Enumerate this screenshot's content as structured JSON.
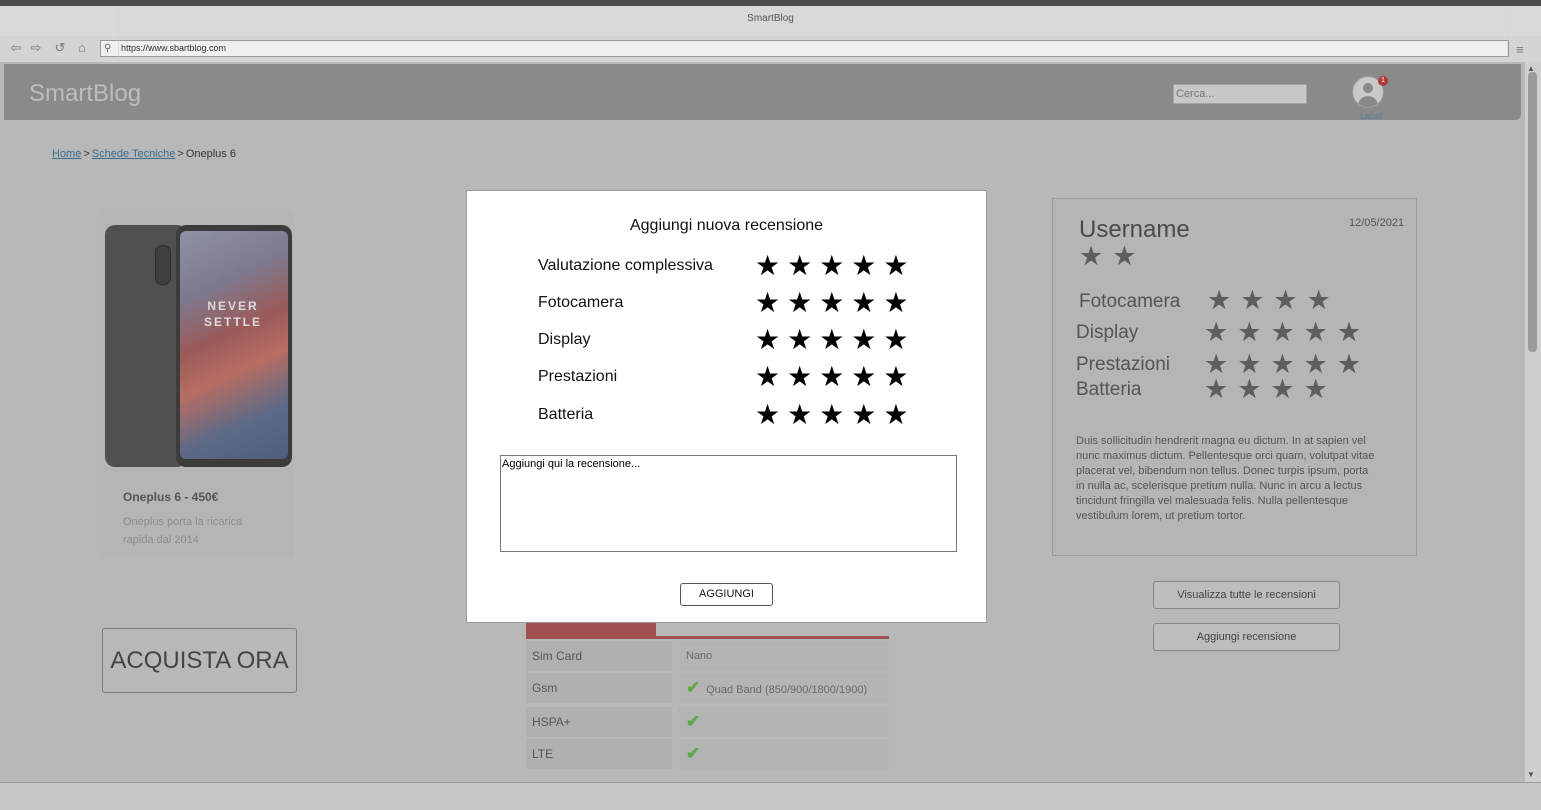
{
  "browser": {
    "window_title": "SmartBlog",
    "url": "https://www.sbartblog.com"
  },
  "header": {
    "logo": "SmartBlog",
    "search_placeholder": "Cerca...",
    "notification_count": "1",
    "avatar_label": "Label"
  },
  "breadcrumb": {
    "home": "Home",
    "section": "Schede Tecniche",
    "current": "Oneplus 6",
    "separator": ">"
  },
  "product": {
    "phone_screen_text_line1": "NEVER",
    "phone_screen_text_line2": "SETTLE",
    "title": "Oneplus 6 - 450€",
    "description": "Oneplus porta la ricarica rapida dal 2014",
    "buy_label": "ACQUISTA ORA"
  },
  "specs": [
    {
      "label": "Sim Card",
      "value": "Nano",
      "check": false
    },
    {
      "label": "Gsm",
      "value": "Quad Band (850/900/1800/1900)",
      "check": true
    },
    {
      "label": "HSPA+",
      "value": "",
      "check": true
    },
    {
      "label": "LTE",
      "value": "",
      "check": true
    }
  ],
  "review_card": {
    "username": "Username",
    "date": "12/05/2021",
    "overall_stars": "★★",
    "rows": [
      {
        "label": "Fotocamera",
        "stars": "★★★★"
      },
      {
        "label": "Display",
        "stars": "★★★★★"
      },
      {
        "label": "Prestazioni",
        "stars": "★★★★★"
      },
      {
        "label": "Batteria",
        "stars": "★★★★"
      }
    ],
    "text": "Duis sollicitudin hendrerit magna eu dictum. In at sapien vel nunc maximus dictum. Pellentesque orci quam, volutpat vitae placerat vel, bibendum non tellus. Donec turpis ipsum, porta in nulla ac, scelerisque pretium nulla. Nunc in arcu a lectus tincidunt fringilla vel malesuada felis. Nulla pellentesque vestibulum lorem, ut pretium tortor."
  },
  "right_buttons": {
    "view_all": "Visualizza tutte le recensioni",
    "add_review": "Aggiungi recensione"
  },
  "modal": {
    "title": "Aggiungi nuova recensione",
    "rows": [
      {
        "label": "Valutazione complessiva",
        "stars": "★★★★★"
      },
      {
        "label": "Fotocamera",
        "stars": "★★★★★"
      },
      {
        "label": "Display",
        "stars": "★★★★★"
      },
      {
        "label": "Prestazioni",
        "stars": "★★★★★"
      },
      {
        "label": "Batteria",
        "stars": "★★★★★"
      }
    ],
    "textarea_value": "Aggiungi qui la recensione...",
    "submit_label": "AGGIUNGI"
  },
  "colors": {
    "accent_red": "#a05050",
    "check_green": "#5fa84a",
    "link_blue": "#3d6b8c"
  },
  "icons": [
    "back-icon",
    "forward-icon",
    "reload-icon",
    "home-icon",
    "search-icon",
    "menu-icon",
    "user-icon",
    "check-icon",
    "star-icon"
  ]
}
